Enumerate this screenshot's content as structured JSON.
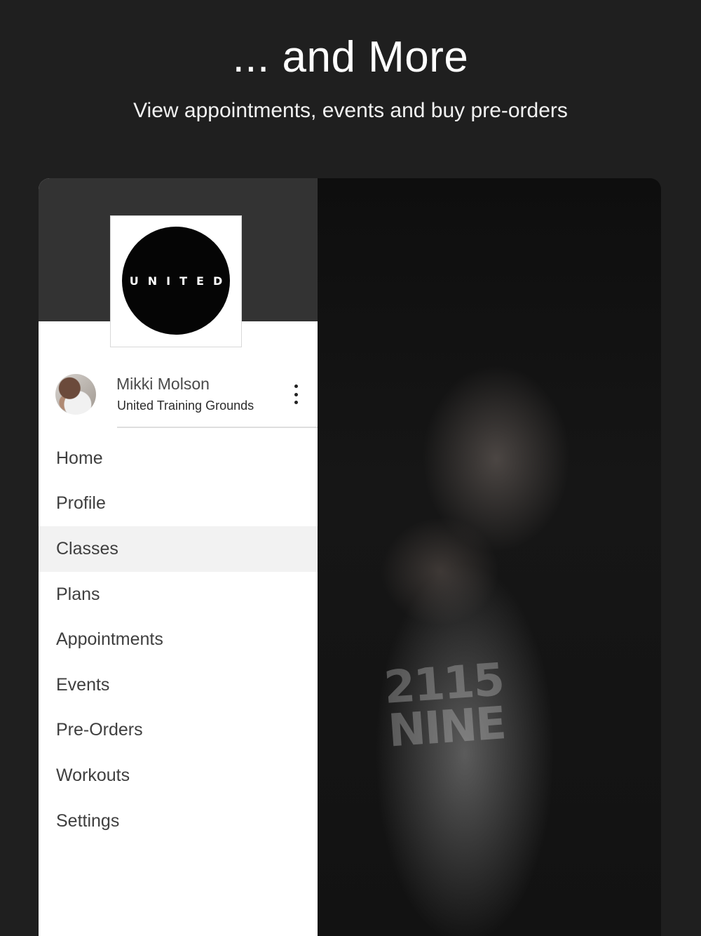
{
  "header": {
    "title": "... and More",
    "subtitle": "View appointments, events and buy pre-orders"
  },
  "drawer": {
    "logo_text": "UNITED",
    "user": {
      "name": "Mikki Molson",
      "gym": "United Training Grounds"
    },
    "active_item": "Classes",
    "items": [
      {
        "label": "Home"
      },
      {
        "label": "Profile"
      },
      {
        "label": "Classes"
      },
      {
        "label": "Plans"
      },
      {
        "label": "Appointments"
      },
      {
        "label": "Events"
      },
      {
        "label": "Pre-Orders"
      },
      {
        "label": "Workouts"
      },
      {
        "label": "Settings"
      }
    ]
  },
  "photo": {
    "shirt_text": "2115 NINE"
  },
  "colors": {
    "background": "#1f1f1f",
    "drawer_header": "#333333",
    "active_row": "#f2f2f2",
    "nav_text": "#3f3f3f"
  },
  "icons": {
    "more": "more-vertical-icon"
  }
}
